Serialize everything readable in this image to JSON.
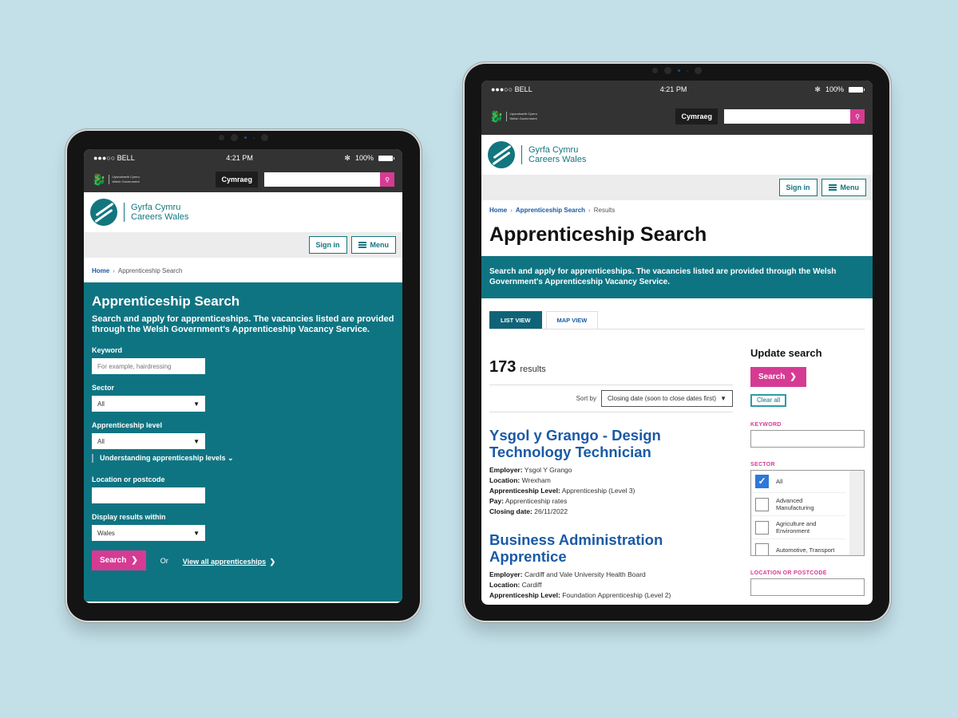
{
  "status": {
    "carrier": "●●●○○ BELL",
    "time": "4:21 PM",
    "battery": "100%"
  },
  "header": {
    "gov_logo_line1": "Llywodraeth Cymru",
    "gov_logo_line2": "Welsh Government",
    "language_button": "Cymraeg",
    "search_button_icon": "search-icon",
    "brand_line1": "Gyrfa Cymru",
    "brand_line2": "Careers Wales",
    "sign_in": "Sign in",
    "menu": "Menu"
  },
  "left": {
    "breadcrumb": [
      "Home",
      "Apprenticeship Search"
    ],
    "title": "Apprenticeship Search",
    "intro": "Search and apply for apprenticeships. The vacancies listed are provided through the Welsh Government's Apprenticeship Vacancy Service.",
    "keyword_label": "Keyword",
    "keyword_placeholder": "For example, hairdressing",
    "sector_label": "Sector",
    "sector_value": "All",
    "level_label": "Apprenticeship level",
    "level_value": "All",
    "understanding_link": "Understanding apprenticeship levels ⌄",
    "location_label": "Location or postcode",
    "location_value": "",
    "within_label": "Display results within",
    "within_value": "Wales",
    "search_button": "Search",
    "or": "Or",
    "view_all": "View all apprenticeships"
  },
  "right": {
    "breadcrumb": [
      "Home",
      "Apprenticeship Search",
      "Results"
    ],
    "title": "Apprenticeship Search",
    "intro": "Search and apply for apprenticeships. The vacancies listed are provided through the Welsh Government's Apprenticeship Vacancy Service.",
    "tabs": [
      {
        "label": "LIST VIEW",
        "active": true
      },
      {
        "label": "MAP VIEW",
        "active": false
      }
    ],
    "result_count": "173",
    "result_label": "results",
    "sort_label": "Sort by",
    "sort_value": "Closing date (soon to close dates first)",
    "jobs": [
      {
        "title": "Ysgol y Grango - Design Technology Technician",
        "employer": "Ysgol Y Grango",
        "location": "Wrexham",
        "level": "Apprenticeship (Level 3)",
        "pay": "Apprenticeship rates",
        "closing": "26/11/2022"
      },
      {
        "title": "Business Administration Apprentice",
        "employer": "Cardiff and Vale University Health Board",
        "location": "Cardiff",
        "level": "Foundation Apprenticeship (Level 2)"
      }
    ],
    "field_labels": {
      "employer": "Employer:",
      "location": "Location:",
      "level": "Apprenticeship Level:",
      "pay": "Pay:",
      "closing": "Closing date:"
    },
    "sidebar": {
      "title": "Update search",
      "search_button": "Search",
      "clear_all": "Clear all",
      "keyword_label": "KEYWORD",
      "sector_label": "SECTOR",
      "sectors": [
        {
          "label": "All",
          "checked": true
        },
        {
          "label": "Advanced Manufacturing",
          "checked": false
        },
        {
          "label": "Agriculture and Environment",
          "checked": false
        },
        {
          "label": "Automotive, Transport",
          "checked": false
        }
      ],
      "location_label": "LOCATION OR POSTCODE"
    }
  },
  "colors": {
    "teal": "#0f7482",
    "pink": "#d63b93",
    "link_blue": "#1a5aa6",
    "background": "#c3dfe8"
  }
}
